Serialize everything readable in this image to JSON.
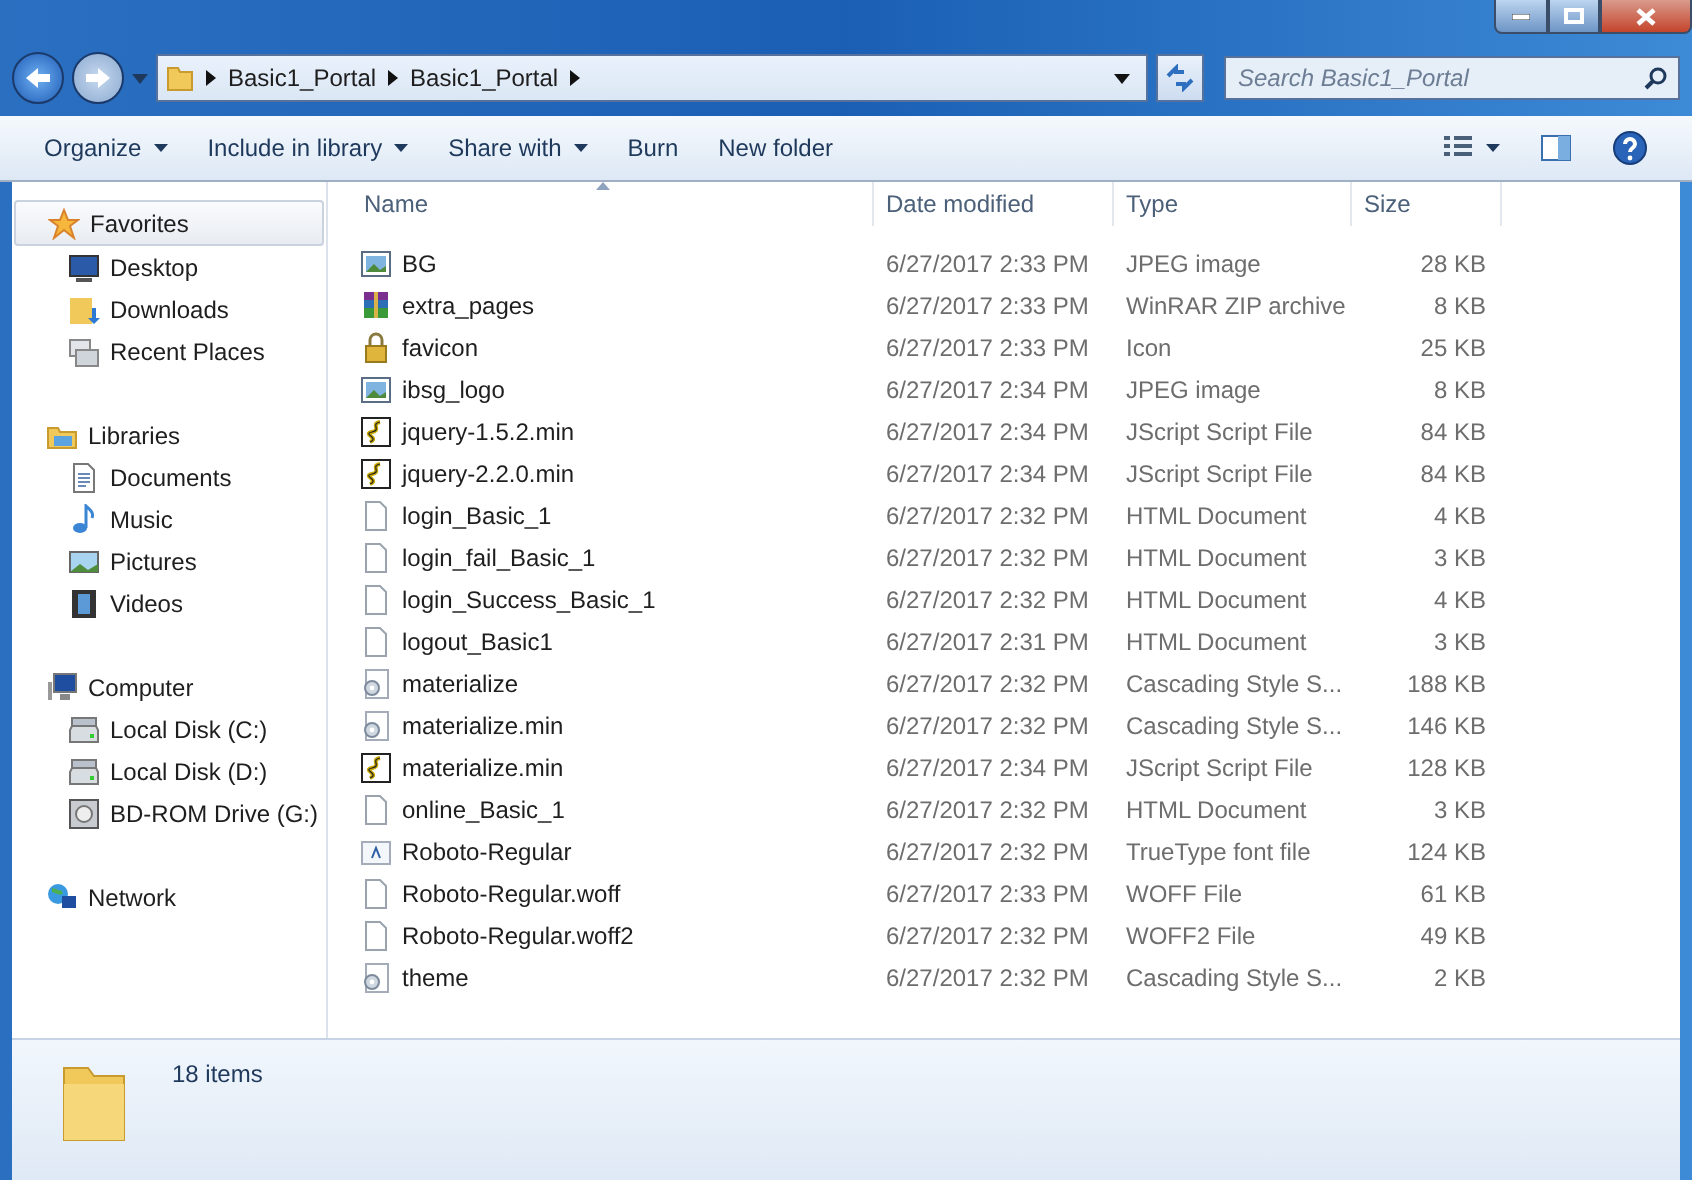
{
  "address": {
    "crumbs": [
      "Basic1_Portal",
      "Basic1_Portal"
    ]
  },
  "search": {
    "placeholder": "Search Basic1_Portal"
  },
  "toolbar": {
    "buttons": [
      {
        "label": "Organize",
        "dropdown": true
      },
      {
        "label": "Include in library",
        "dropdown": true
      },
      {
        "label": "Share with",
        "dropdown": true
      },
      {
        "label": "Burn",
        "dropdown": false
      },
      {
        "label": "New folder",
        "dropdown": false
      }
    ]
  },
  "sidebar": {
    "groups": [
      {
        "label": "Favorites",
        "kind": "star",
        "selected": true,
        "children": [
          {
            "label": "Desktop",
            "kind": "desktop"
          },
          {
            "label": "Downloads",
            "kind": "downloads"
          },
          {
            "label": "Recent Places",
            "kind": "recent"
          }
        ]
      },
      {
        "label": "Libraries",
        "kind": "library",
        "selected": false,
        "children": [
          {
            "label": "Documents",
            "kind": "document"
          },
          {
            "label": "Music",
            "kind": "music"
          },
          {
            "label": "Pictures",
            "kind": "pictures"
          },
          {
            "label": "Videos",
            "kind": "videos"
          }
        ]
      },
      {
        "label": "Computer",
        "kind": "computer",
        "selected": false,
        "children": [
          {
            "label": "Local Disk (C:)",
            "kind": "disk"
          },
          {
            "label": "Local Disk (D:)",
            "kind": "disk"
          },
          {
            "label": "BD-ROM Drive (G:)",
            "kind": "optical"
          }
        ]
      },
      {
        "label": "Network",
        "kind": "network",
        "selected": false
      }
    ]
  },
  "table": {
    "columns": [
      "Name",
      "Date modified",
      "Type",
      "Size"
    ],
    "rows": [
      {
        "name": "BG",
        "date": "6/27/2017 2:33 PM",
        "type": "JPEG image",
        "size": "28 KB",
        "kind": "image"
      },
      {
        "name": "extra_pages",
        "date": "6/27/2017 2:33 PM",
        "type": "WinRAR ZIP archive",
        "size": "8 KB",
        "kind": "archive"
      },
      {
        "name": "favicon",
        "date": "6/27/2017 2:33 PM",
        "type": "Icon",
        "size": "25 KB",
        "kind": "lock"
      },
      {
        "name": "ibsg_logo",
        "date": "6/27/2017 2:34 PM",
        "type": "JPEG image",
        "size": "8 KB",
        "kind": "image"
      },
      {
        "name": "jquery-1.5.2.min",
        "date": "6/27/2017 2:34 PM",
        "type": "JScript Script File",
        "size": "84 KB",
        "kind": "script"
      },
      {
        "name": "jquery-2.2.0.min",
        "date": "6/27/2017 2:34 PM",
        "type": "JScript Script File",
        "size": "84 KB",
        "kind": "script"
      },
      {
        "name": "login_Basic_1",
        "date": "6/27/2017 2:32 PM",
        "type": "HTML Document",
        "size": "4 KB",
        "kind": "blank"
      },
      {
        "name": "login_fail_Basic_1",
        "date": "6/27/2017 2:32 PM",
        "type": "HTML Document",
        "size": "3 KB",
        "kind": "blank"
      },
      {
        "name": "login_Success_Basic_1",
        "date": "6/27/2017 2:32 PM",
        "type": "HTML Document",
        "size": "4 KB",
        "kind": "blank"
      },
      {
        "name": "logout_Basic1",
        "date": "6/27/2017 2:31 PM",
        "type": "HTML Document",
        "size": "3 KB",
        "kind": "blank"
      },
      {
        "name": "materialize",
        "date": "6/27/2017 2:32 PM",
        "type": "Cascading Style S...",
        "size": "188 KB",
        "kind": "css"
      },
      {
        "name": "materialize.min",
        "date": "6/27/2017 2:32 PM",
        "type": "Cascading Style S...",
        "size": "146 KB",
        "kind": "css"
      },
      {
        "name": "materialize.min",
        "date": "6/27/2017 2:34 PM",
        "type": "JScript Script File",
        "size": "128 KB",
        "kind": "script"
      },
      {
        "name": "online_Basic_1",
        "date": "6/27/2017 2:32 PM",
        "type": "HTML Document",
        "size": "3 KB",
        "kind": "blank"
      },
      {
        "name": "Roboto-Regular",
        "date": "6/27/2017 2:32 PM",
        "type": "TrueType font file",
        "size": "124 KB",
        "kind": "font"
      },
      {
        "name": "Roboto-Regular.woff",
        "date": "6/27/2017 2:33 PM",
        "type": "WOFF File",
        "size": "61 KB",
        "kind": "blank"
      },
      {
        "name": "Roboto-Regular.woff2",
        "date": "6/27/2017 2:32 PM",
        "type": "WOFF2 File",
        "size": "49 KB",
        "kind": "blank"
      },
      {
        "name": "theme",
        "date": "6/27/2017 2:32 PM",
        "type": "Cascading Style S...",
        "size": "2 KB",
        "kind": "css"
      }
    ]
  },
  "details": {
    "count": "18 items"
  }
}
